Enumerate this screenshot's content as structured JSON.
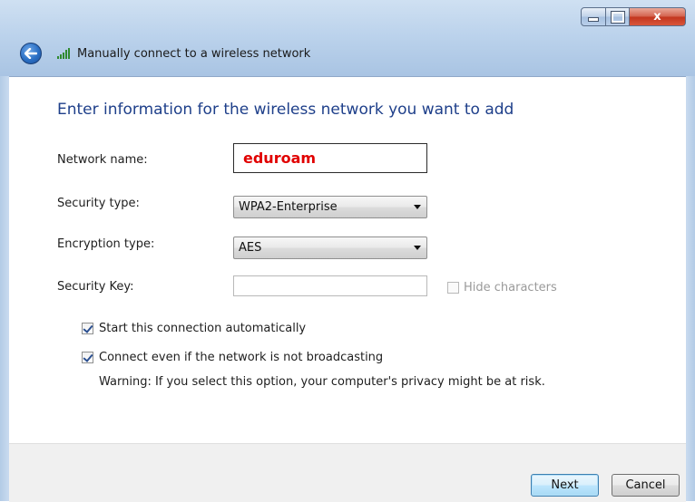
{
  "window": {
    "title": "Manually connect to a wireless network",
    "controls": {
      "minimize": "minimize",
      "maximize": "maximize",
      "close": "x"
    }
  },
  "form": {
    "heading": "Enter information for the wireless network you want to add",
    "network_name": {
      "label": "Network name:",
      "value": "eduroam"
    },
    "security_type": {
      "label": "Security type:",
      "value": "WPA2-Enterprise"
    },
    "encryption_type": {
      "label": "Encryption type:",
      "value": "AES"
    },
    "security_key": {
      "label": "Security Key:",
      "value": "",
      "hide_characters_label": "Hide characters",
      "hide_characters_checked": false
    },
    "options": {
      "start_automatically": {
        "label": "Start this connection automatically",
        "checked": true
      },
      "connect_not_broadcasting": {
        "label": "Connect even if the network is not broadcasting",
        "checked": true
      }
    },
    "warning": "Warning: If you select this option, your computer's privacy might be at risk."
  },
  "footer": {
    "next_label": "Next",
    "cancel_label": "Cancel"
  },
  "colors": {
    "heading": "#1e3f8a",
    "network_name_text": "#e10000",
    "title_bar": "#bcd3ec"
  },
  "icons": {
    "back": "back-arrow-icon",
    "network": "wifi-signal-icon"
  }
}
